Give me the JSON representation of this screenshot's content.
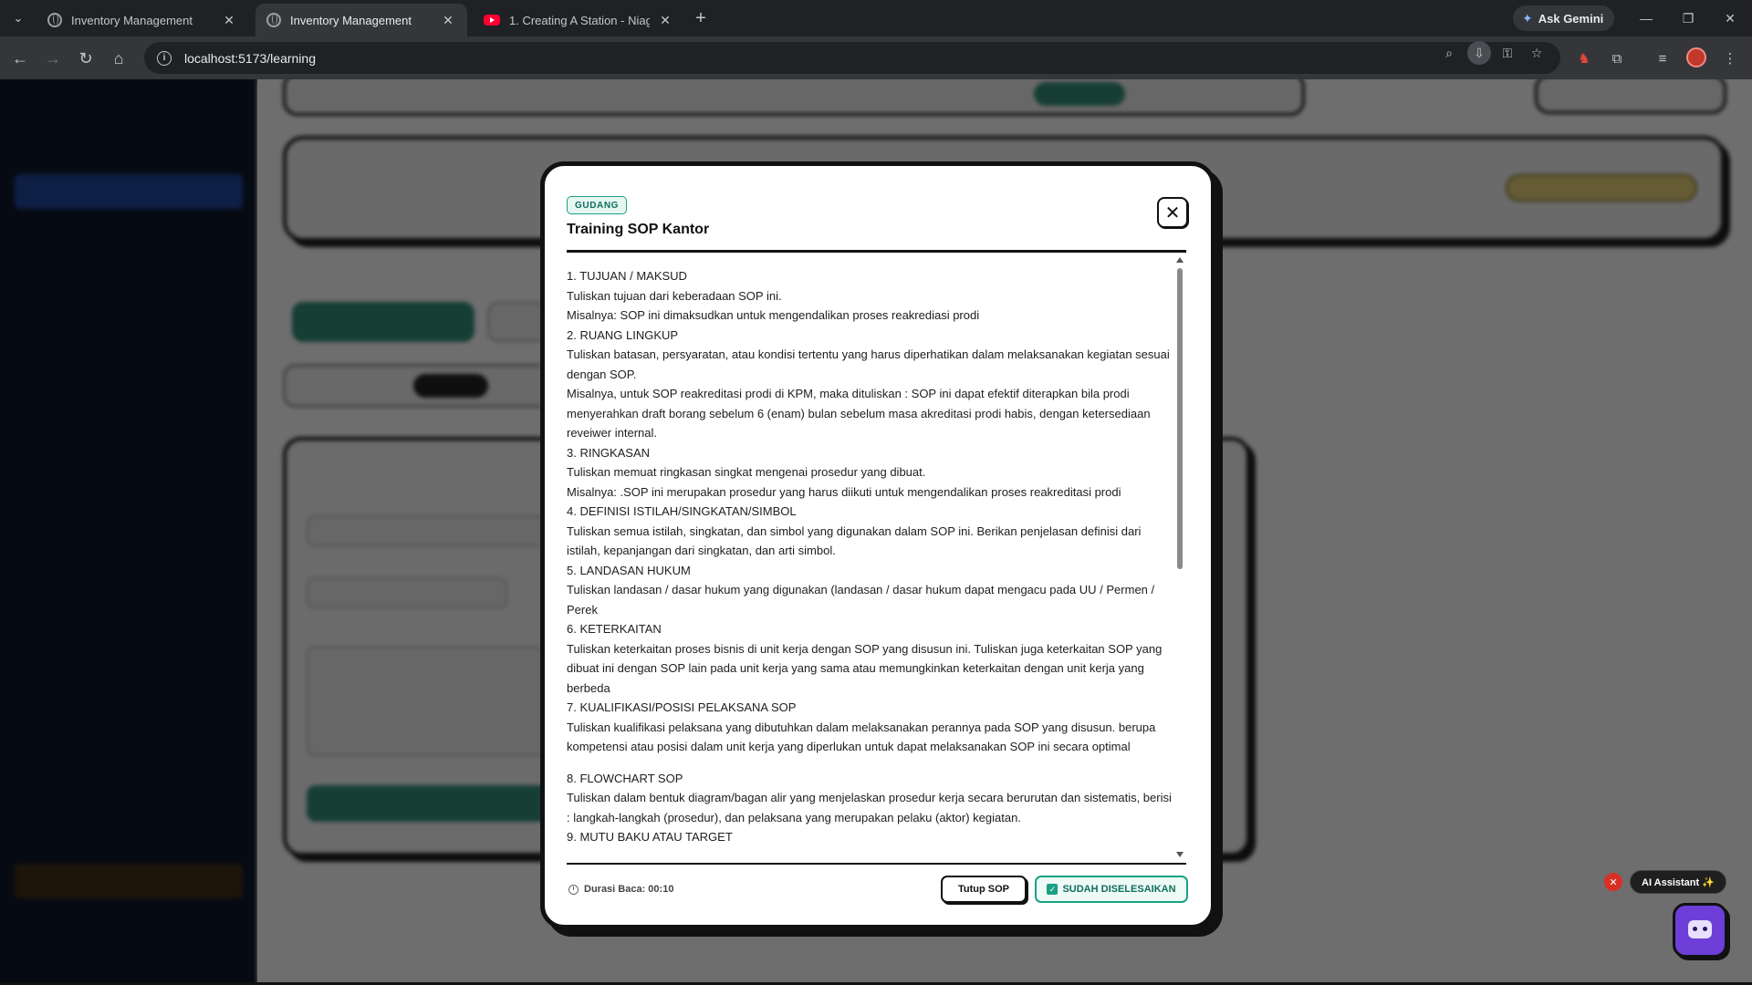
{
  "browser": {
    "tabs": [
      {
        "title": "Inventory Management",
        "icon": "globe-icon",
        "active": false
      },
      {
        "title": "Inventory Management",
        "icon": "globe-icon",
        "active": true
      },
      {
        "title": "1. Creating A Station - Niagara",
        "icon": "youtube-icon",
        "active": false
      }
    ],
    "gemini_label": "Ask Gemini",
    "url": "localhost:5173/learning"
  },
  "modal": {
    "tag": "GUDANG",
    "title": "Training SOP Kantor",
    "lines": [
      "1. TUJUAN / MAKSUD",
      "Tuliskan tujuan dari keberadaan SOP ini.",
      "Misalnya: SOP ini dimaksudkan untuk mengendalikan proses reakrediasi prodi",
      "2. RUANG LINGKUP",
      "Tuliskan batasan, persyaratan, atau kondisi tertentu yang harus diperhatikan dalam melaksanakan kegiatan sesuai dengan SOP.",
      "Misalnya, untuk SOP reakreditasi prodi di KPM, maka dituliskan : SOP ini dapat efektif diterapkan bila prodi menyerahkan draft borang sebelum 6 (enam) bulan sebelum masa akreditasi prodi habis, dengan ketersediaan reveiwer internal.",
      "3. RINGKASAN",
      "Tuliskan memuat ringkasan singkat mengenai prosedur yang dibuat.",
      "Misalnya: .SOP ini merupakan prosedur yang harus diikuti untuk mengendalikan proses reakreditasi prodi",
      "4. DEFINISI ISTILAH/SINGKATAN/SIMBOL",
      "Tuliskan semua istilah, singkatan, dan simbol yang digunakan dalam SOP ini. Berikan penjelasan definisi dari istilah, kepanjangan dari singkatan, dan arti simbol.",
      "5. LANDASAN HUKUM",
      "Tuliskan landasan / dasar hukum yang digunakan (landasan / dasar hukum dapat mengacu pada UU / Permen / Perek",
      "6. KETERKAITAN",
      "Tuliskan keterkaitan proses bisnis di unit kerja dengan SOP yang disusun ini. Tuliskan juga keterkaitan SOP yang dibuat ini dengan SOP lain pada unit kerja yang sama atau memungkinkan keterkaitan dengan unit kerja yang berbeda",
      "7. KUALIFIKASI/POSISI PELAKSANA SOP",
      "Tuliskan kualifikasi pelaksana yang dibutuhkan dalam melaksanakan perannya pada SOP yang disusun. berupa kompetensi atau posisi dalam unit kerja yang diperlukan untuk dapat melaksanakan SOP ini secara optimal",
      "",
      "8. FLOWCHART SOP",
      "Tuliskan dalam bentuk diagram/bagan alir yang menjelaskan prosedur kerja secara berurutan dan sistematis, berisi : langkah-langkah (prosedur), dan pelaksana yang merupakan pelaku (aktor) kegiatan.",
      "9. MUTU BAKU ATAU TARGET"
    ],
    "reading_label": "Durasi Baca: 00:10",
    "close_button": "Tutup SOP",
    "done_button": "SUDAH DISELESAIKAN"
  },
  "assistant": {
    "label": "AI Assistant ✨"
  }
}
